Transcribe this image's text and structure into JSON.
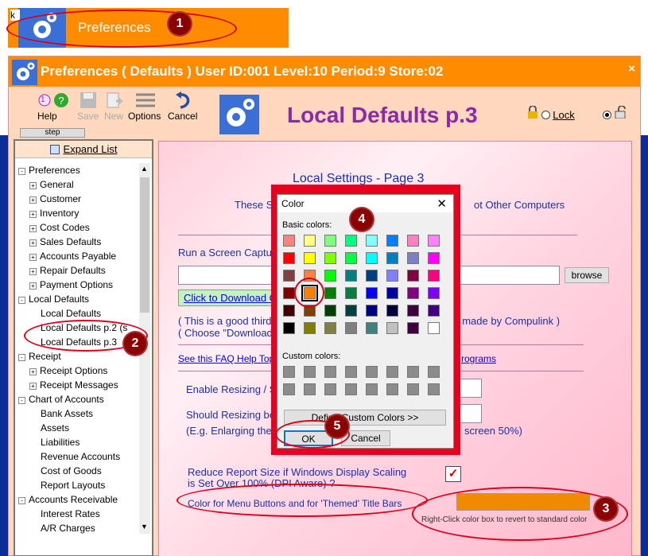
{
  "top_button": {
    "k": "k",
    "label": "Preferences"
  },
  "window": {
    "title": "Preferences ( Defaults )    User ID:001 Level:10 Period:9 Store:02",
    "close": "×"
  },
  "toolbar": {
    "help": "Help",
    "save": "Save",
    "new": "New",
    "options": "Options",
    "cancel": "Cancel",
    "step": "step",
    "help_badge": "1"
  },
  "heading": "Local Defaults p.3",
  "lock": {
    "label": "Lock"
  },
  "tree": {
    "expand": "Expand List",
    "items": [
      {
        "label": "Preferences",
        "pm": "-"
      },
      {
        "label": "General",
        "pm": "+"
      },
      {
        "label": "Customer",
        "pm": "+"
      },
      {
        "label": "Inventory",
        "pm": "+"
      },
      {
        "label": "Cost Codes",
        "pm": "+"
      },
      {
        "label": "Sales Defaults",
        "pm": "+"
      },
      {
        "label": "Accounts Payable",
        "pm": "+"
      },
      {
        "label": "Repair Defaults",
        "pm": "+"
      },
      {
        "label": "Payment Options",
        "pm": "+"
      },
      {
        "label": "Local Defaults",
        "pm": "-"
      },
      {
        "label": "Local Defaults",
        "pm": ""
      },
      {
        "label": "Local Defaults p.2 (s",
        "pm": ""
      },
      {
        "label": "Local Defaults p.3",
        "pm": ""
      },
      {
        "label": "Receipt",
        "pm": "-"
      },
      {
        "label": "Receipt Options",
        "pm": "+"
      },
      {
        "label": "Receipt Messages",
        "pm": "+"
      },
      {
        "label": "Chart of Accounts",
        "pm": "-"
      },
      {
        "label": "Bank Assets",
        "pm": ""
      },
      {
        "label": "Assets",
        "pm": ""
      },
      {
        "label": "Liabilities",
        "pm": ""
      },
      {
        "label": "Revenue Accounts",
        "pm": ""
      },
      {
        "label": "Cost of Goods",
        "pm": ""
      },
      {
        "label": "Report Layouts",
        "pm": ""
      },
      {
        "label": "Accounts Receivable",
        "pm": "-"
      },
      {
        "label": "Interest Rates",
        "pm": ""
      },
      {
        "label": "A/R Charges",
        "pm": ""
      }
    ]
  },
  "content": {
    "title": "Local Settings - Page 3",
    "sub_left": "These S",
    "sub_right": "ot Other Computers",
    "capture": "Run a Screen Captur",
    "browse": "browse",
    "download": "Click to Download G",
    "line1a": "( This is a good third",
    "line1b": "t made by Compulink )",
    "line2a": "( Choose \"Download",
    "faq_a": "See this FAQ Help Top",
    "faq_b": "rograms",
    "resize1": "Enable Resizing / S",
    "resize2": "Should Resizing be",
    "resize3": "(E.g. Enlarging the",
    "resize3b": "screen 50%)",
    "reduce1": "Reduce Report Size if Windows Display Scaling",
    "reduce2": "is Set Over 100% (DPI Aware) ?",
    "color_label": "Color for Menu Buttons and for 'Themed' Title Bars",
    "rightclick": "Right-Click color box to revert to standard color",
    "color_value": "#f08a00"
  },
  "dialog": {
    "title": "Color",
    "basic": "Basic colors:",
    "custom": "Custom colors:",
    "define": "Define Custom Colors >>",
    "ok": "OK",
    "cancel": "Cancel",
    "basic_colors": [
      [
        "#ff8080",
        "#ffff80",
        "#80ff80",
        "#00ff80",
        "#80ffff",
        "#0080ff",
        "#ff80c0",
        "#ff80ff"
      ],
      [
        "#ff0000",
        "#ffff00",
        "#80ff00",
        "#00ff40",
        "#00ffff",
        "#0080c0",
        "#8080c0",
        "#ff00ff"
      ],
      [
        "#804040",
        "#ff8040",
        "#00ff00",
        "#008080",
        "#004080",
        "#8080ff",
        "#800040",
        "#ff0080"
      ],
      [
        "#800000",
        "#ff8000",
        "#008000",
        "#008040",
        "#0000ff",
        "#0000a0",
        "#800080",
        "#8000ff"
      ],
      [
        "#400000",
        "#804000",
        "#004000",
        "#004040",
        "#000080",
        "#000040",
        "#400040",
        "#400080"
      ],
      [
        "#000000",
        "#808000",
        "#808040",
        "#808080",
        "#408080",
        "#c0c0c0",
        "#400040",
        "#ffffff"
      ]
    ]
  },
  "callouts": [
    "1",
    "2",
    "3",
    "4",
    "5"
  ]
}
